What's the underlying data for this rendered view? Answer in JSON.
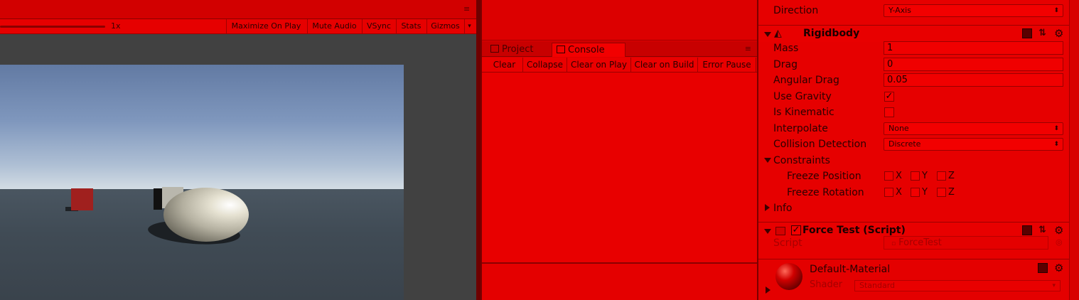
{
  "game_view": {
    "time_scale": "1x",
    "toolbar_buttons": [
      "Maximize On Play",
      "Mute Audio",
      "VSync",
      "Stats",
      "Gizmos"
    ],
    "menu_icon": "≡"
  },
  "console_panel": {
    "tabs": [
      {
        "label": "Project",
        "icon": "folder-icon"
      },
      {
        "label": "Console",
        "icon": "console-icon"
      }
    ],
    "toolbar_buttons": [
      "Clear",
      "Collapse",
      "Clear on Play",
      "Clear on Build",
      "Error Pause"
    ],
    "menu_icon": "≡"
  },
  "inspector": {
    "direction": {
      "label": "Direction",
      "value": "Y-Axis"
    },
    "rigidbody": {
      "title": "Rigidbody",
      "mass": {
        "label": "Mass",
        "value": "1"
      },
      "drag": {
        "label": "Drag",
        "value": "0"
      },
      "angular_drag": {
        "label": "Angular Drag",
        "value": "0.05"
      },
      "use_gravity": {
        "label": "Use Gravity",
        "checked": true
      },
      "is_kinematic": {
        "label": "Is Kinematic",
        "checked": false
      },
      "interpolate": {
        "label": "Interpolate",
        "value": "None"
      },
      "collision_detection": {
        "label": "Collision Detection",
        "value": "Discrete"
      },
      "constraints": {
        "label": "Constraints",
        "freeze_position": {
          "label": "Freeze Position",
          "axes": [
            "X",
            "Y",
            "Z"
          ]
        },
        "freeze_rotation": {
          "label": "Freeze Rotation",
          "axes": [
            "X",
            "Y",
            "Z"
          ]
        }
      },
      "info": {
        "label": "Info"
      }
    },
    "force_test": {
      "title": "Force Test (Script)",
      "script_label": "Script",
      "script_value": "ForceTest"
    },
    "material": {
      "name": "Default-Material",
      "shader_label": "Shader",
      "shader_value": "Standard"
    }
  },
  "colors": {
    "tint": "#e00000",
    "tint_dark": "#8a0000",
    "sky_top": "#627aa3",
    "horizon": "#d4dde4",
    "ground": "#404b55",
    "cube": "#a0201e"
  }
}
